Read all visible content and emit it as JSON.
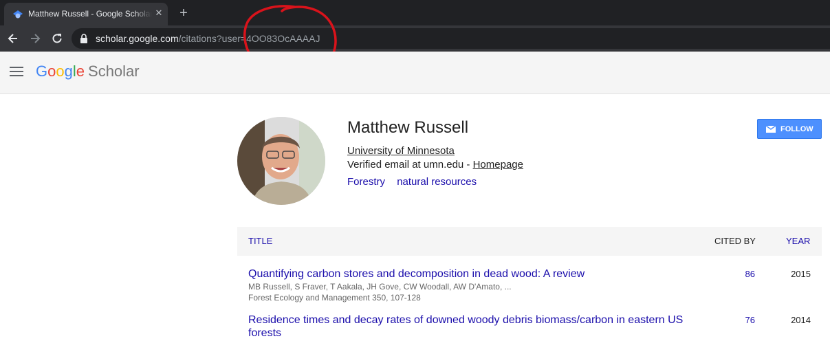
{
  "browser": {
    "tab_title": "Matthew Russell - Google Scholar",
    "tab_close": "✕",
    "new_tab": "+",
    "url_host": "scholar.google.com",
    "url_path": "/citations?user=4OO83OcAAAAJ"
  },
  "header": {
    "logo_letters": [
      "G",
      "o",
      "o",
      "g",
      "l",
      "e"
    ],
    "logo_product": "Scholar"
  },
  "profile": {
    "name": "Matthew Russell",
    "affiliation": "University of Minnesota",
    "email_text": "Verified email at umn.edu - ",
    "homepage_label": "Homepage",
    "interests": [
      "Forestry",
      "natural resources"
    ],
    "follow_label": "FOLLOW"
  },
  "table": {
    "headers": {
      "title": "TITLE",
      "cited_by": "CITED BY",
      "year": "YEAR"
    },
    "rows": [
      {
        "title": "Quantifying carbon stores and decomposition in dead wood: A review",
        "authors": "MB Russell, S Fraver, T Aakala, JH Gove, CW Woodall, AW D'Amato, ...",
        "venue": "Forest Ecology and Management 350, 107-128",
        "cited_by": "86",
        "year": "2015"
      },
      {
        "title": "Residence times and decay rates of downed woody debris biomass/carbon in eastern US forests",
        "authors": "",
        "venue": "",
        "cited_by": "76",
        "year": "2014"
      }
    ]
  },
  "colors": {
    "annotation": "#d9131b",
    "link": "#1a0dab",
    "follow_bg": "#4d90fe"
  }
}
